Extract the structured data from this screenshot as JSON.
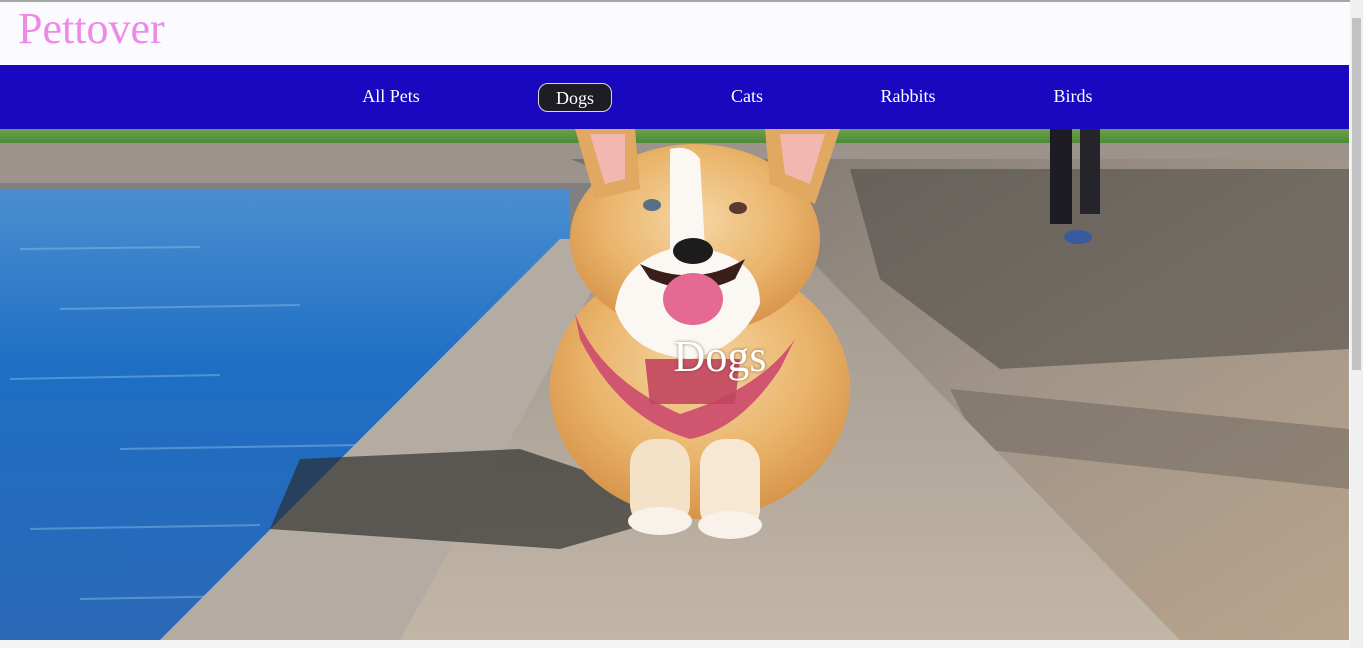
{
  "site": {
    "logo": "Pettover"
  },
  "nav": {
    "items": [
      {
        "label": "All Pets",
        "active": false
      },
      {
        "label": "Dogs",
        "active": true
      },
      {
        "label": "Cats",
        "active": false
      },
      {
        "label": "Rabbits",
        "active": false
      },
      {
        "label": "Birds",
        "active": false
      }
    ]
  },
  "hero": {
    "title": "Dogs",
    "image": "corgi-running-on-waterside-ledge"
  },
  "colors": {
    "logo": "#ec8ae6",
    "navbar": "#1a07c0",
    "active_pill": "#1e1c24",
    "nav_text": "#ffffff"
  }
}
